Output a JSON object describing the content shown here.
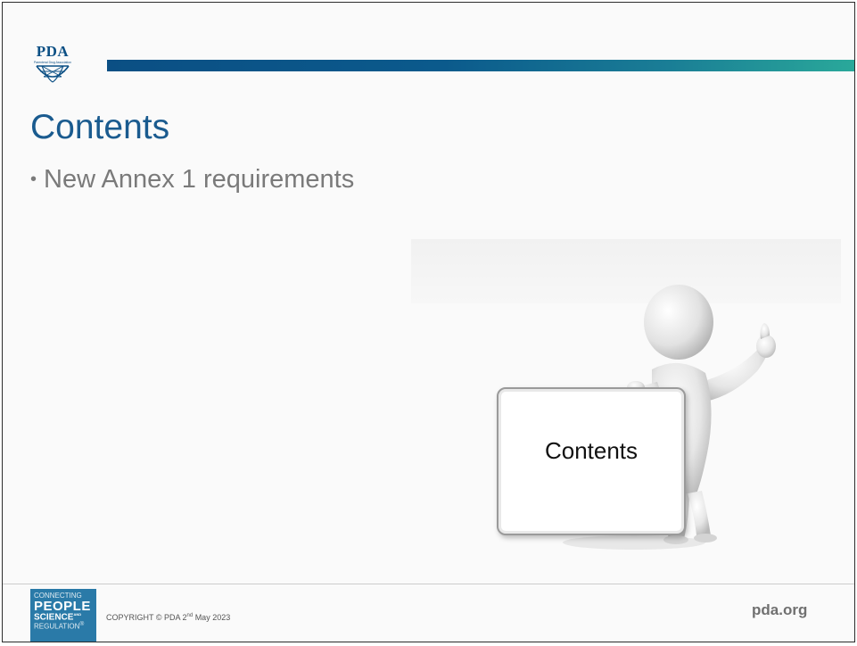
{
  "logo": {
    "text": "PDA",
    "tagline": "Parenteral Drug Association"
  },
  "slide": {
    "title": "Contents",
    "bullets": [
      "New Annex 1 requirements"
    ]
  },
  "figure": {
    "board_text": "Contents"
  },
  "footer": {
    "badge": {
      "line1": "CONNECTING",
      "line2": "PEOPLE",
      "line3": "SCIENCE",
      "line3_sup": "AND",
      "line4": "REGULATION",
      "line4_mark": "®"
    },
    "copyright_prefix": "COPYRIGHT © PDA 2",
    "copyright_sup": "nd",
    "copyright_suffix": " May 2023",
    "site": "pda.org"
  },
  "colors": {
    "brand_blue": "#0b4f84",
    "title_blue": "#1a5b8f",
    "bar_teal": "#2aa99a",
    "badge_blue": "#2a7aa8"
  }
}
